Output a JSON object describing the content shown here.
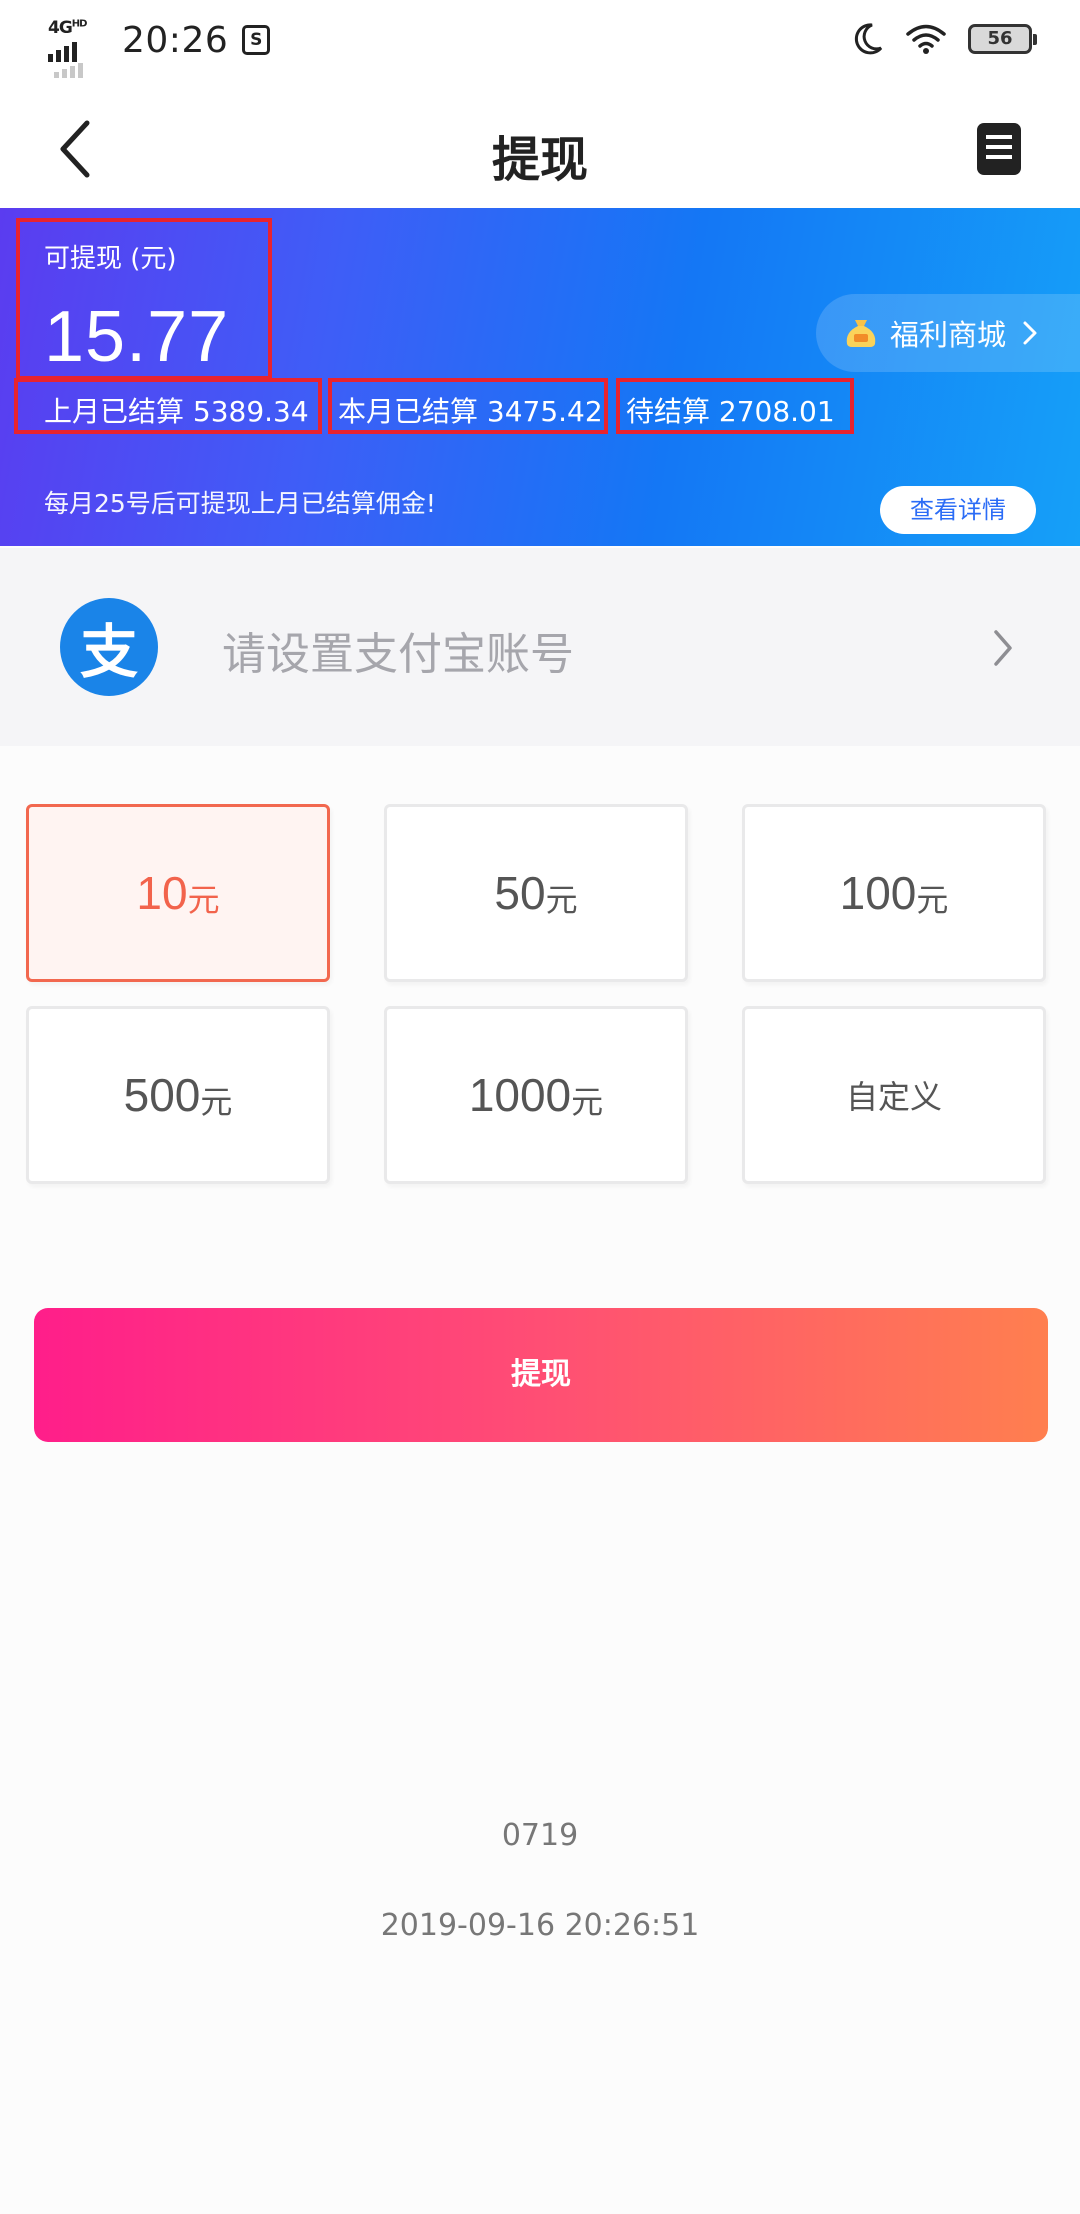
{
  "status_bar": {
    "network": "4G",
    "network_sup": "HD",
    "time": "20:26",
    "s_badge": "S",
    "battery": "56"
  },
  "header": {
    "title": "提现"
  },
  "banner": {
    "balance_label": "可提现 (元)",
    "balance_value": "15.77",
    "stats": [
      "上月已结算 5389.34",
      "本月已结算 3475.42",
      "待结算 2708.01"
    ],
    "mall_label": "福利商城",
    "notice": "每月25号后可提现上月已结算佣金!",
    "detail_button": "查看详情",
    "highlight_color": "#e8232f"
  },
  "alipay": {
    "prompt": "请设置支付宝账号",
    "logo_char": "支",
    "brand_color": "#1a84e8"
  },
  "amounts": [
    {
      "value": "10",
      "unit": "元",
      "selected": true
    },
    {
      "value": "50",
      "unit": "元",
      "selected": false
    },
    {
      "value": "100",
      "unit": "元",
      "selected": false
    },
    {
      "value": "500",
      "unit": "元",
      "selected": false
    },
    {
      "value": "1000",
      "unit": "元",
      "selected": false
    },
    {
      "value": "自定义",
      "unit": "",
      "selected": false
    }
  ],
  "submit_button": "提现",
  "footer": {
    "code": "0719",
    "timestamp": "2019-09-16 20:26:51"
  },
  "icons": {
    "back": "chevron-left-icon",
    "records": "document-icon",
    "mall": "money-bag-icon",
    "alipay": "alipay-icon"
  }
}
